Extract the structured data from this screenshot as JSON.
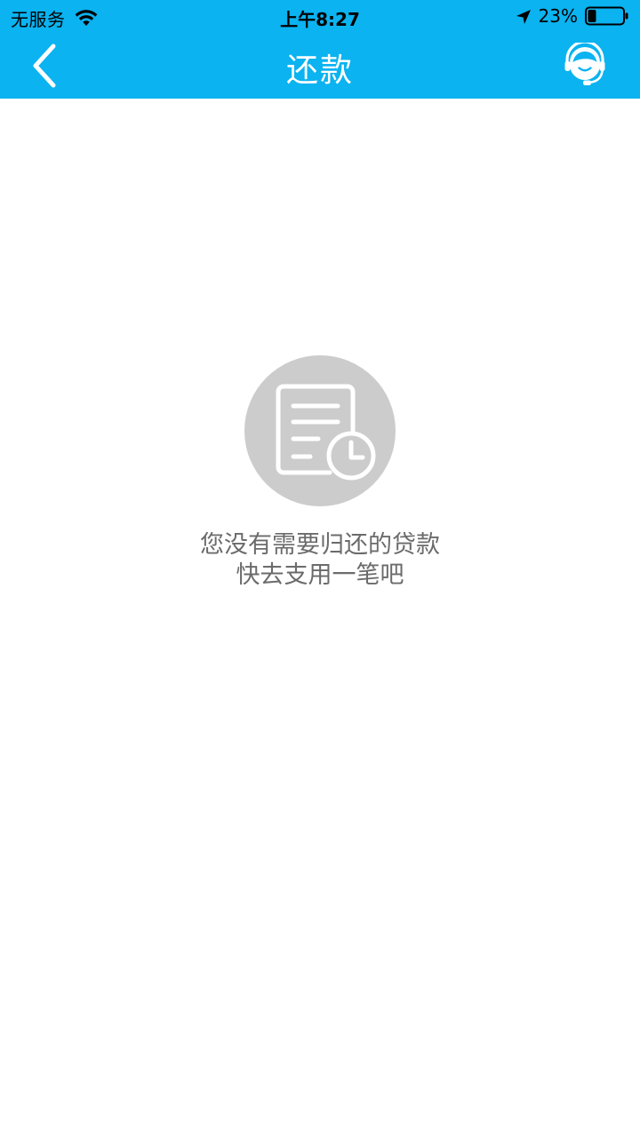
{
  "status_bar": {
    "carrier": "无服务",
    "time": "上午8:27",
    "battery_percent": "23%",
    "wifi_icon": "wifi-icon",
    "location_icon": "location-arrow-icon",
    "battery_icon": "battery-icon",
    "battery_level": 0.23
  },
  "nav": {
    "title": "还款",
    "back_icon": "chevron-left-icon",
    "service_icon": "customer-service-icon"
  },
  "empty_state": {
    "icon": "document-clock-icon",
    "line1": "您没有需要归还的贷款",
    "line2": "快去支用一笔吧"
  },
  "colors": {
    "header_bg": "#0bb3f0",
    "icon_circle": "#cccccc",
    "message_text": "#6b6b6b"
  }
}
